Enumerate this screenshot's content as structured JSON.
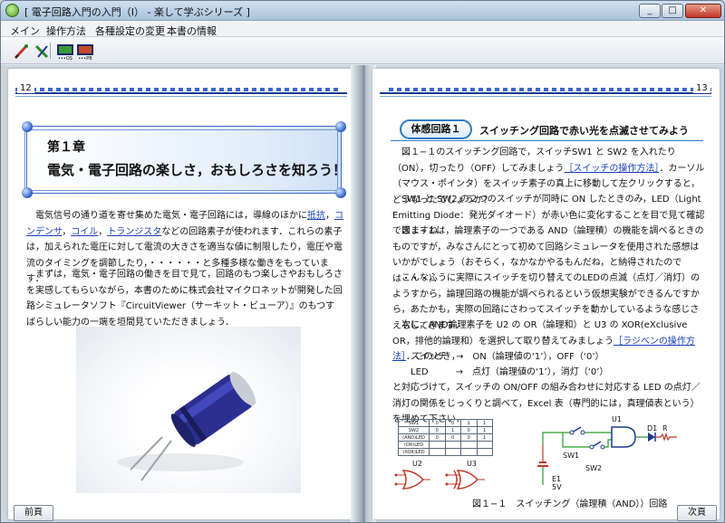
{
  "window": {
    "title": "[ 電子回路入門の入門（Ⅰ） - 楽して学ぶシリーズ ]",
    "min": "_",
    "max": "□",
    "close": "✕"
  },
  "menu": {
    "items": [
      "メイン",
      "操作方法",
      "各種設定の変更",
      "本書の情報"
    ]
  },
  "toolbar": {
    "icons": [
      "pen-icon",
      "eraser-icon",
      "circuit-os-icon",
      "circuit-pb-icon"
    ]
  },
  "left_page": {
    "page_number": "12",
    "chapter_number": "第１章",
    "chapter_title": "電気・電子回路の楽しさ，おもしろさを知ろう！",
    "para1_a": "　電気信号の通り道を寄せ集めた電気・電子回路には，導線のほかに",
    "link_resistor": "抵抗",
    "sep1": "，",
    "link_condenser": "コンデンサ",
    "sep2": "，",
    "link_coil": "コイル",
    "sep3": "，",
    "link_transistor": "トランジスタ",
    "para1_b": "などの回路素子が使われます．これらの素子は，加えられた電圧に対して電流の大きさを適当な値に制限したり，電圧や電流のタイミングを調節したり，・・・・・・と多種多様な働きをもっています．",
    "para2": "　まずは，電気・電子回路の働きを目で見て，回路のもつ楽しさやおもしろさを実感してもらいながら，本書のために株式会社マイクロネットが開発した回路シミュレータソフト『CircuitViewer（サーキット・ビューア）』のもつすばらしい能力の一端を垣間見ていただきましょう．",
    "prev_button": "前頁"
  },
  "right_page": {
    "page_number": "13",
    "badge": "体感回路１",
    "title": "スイッチング回路で赤い光を点滅させてみよう",
    "para1_a": "　図１−１のスイッチング回路で，スイッチSW1 と SW2 を入れたり（ON），切ったり（OFF）してみましょう",
    "link_switch": "［スイッチの操作方法］",
    "para1_b": "．カーソル（マウス・ポインタ）をスイッチ素子の真上に移動して左クリックすると，どうなったでしょうか？",
    "para2": "　SW1 と SW2 の２つのスイッチが同時に ON したときのみ，LED（Light Emitting Diode：発光ダイオード）が赤い色に変化することを目で見て確認できますね．",
    "para3": "　図１−１は，論理素子の一つである AND（論理積）の機能を調べるときのものですが，みなさんにとって初めて回路シミュレータを使用された感想はいかがでしょう（おそらく，なかなかやるもんだね，と納得されたのでは・・・）．",
    "para4": "　こんなふうに実際にスイッチを切り替えてのLEDの点滅（点灯／消灯）のようすから，論理回路の機能が調べられるという仮想実験ができるんですから，あたかも，実際の回路にさわってスイッチを動かしているような感じさえもしてきます．",
    "para5_a": "　次に，AND論理素子を U2 の OR（論理和）と U3 の XOR(eXclusive OR，排他的論理和）を選択して取り替えてみましょう",
    "link_radio": "［ラジベンの操作方法］",
    "para5_b": "．このとき，",
    "map1": "　　スイッチ　→　ON（論理値の‘1’），OFF（‘0’）",
    "map2": "　　LED　　　→　点灯（論理値の‘1’），消灯（‘0’）",
    "para6": "と対応づけて，スイッチの ON/OFF の組み合わせに対応する LED の点灯／消灯の関係をじっくりと調べて，Excel 表（専門的には，真理値表という）を埋めて下さい．",
    "truth_table": [
      [
        "SW1",
        "0",
        "0",
        "1",
        "1"
      ],
      [
        "SW2",
        "0",
        "1",
        "0",
        "1"
      ],
      [
        "(AND)LED",
        "0",
        "0",
        "0",
        "1"
      ],
      [
        "(OR)LED",
        "",
        "",
        "",
        ""
      ],
      [
        "(XOR)LED",
        "",
        "",
        "",
        ""
      ]
    ],
    "gate_u2": "U2",
    "gate_u3": "U3",
    "schem_u1": "U1",
    "schem_sw1": "SW1",
    "schem_sw2": "SW2",
    "schem_d1": "D1",
    "schem_r": "R",
    "schem_e1": "E1",
    "schem_5v": "5V",
    "caption": "図１−１　スイッチング（論理積（AND））回路",
    "next_button": "次頁"
  }
}
